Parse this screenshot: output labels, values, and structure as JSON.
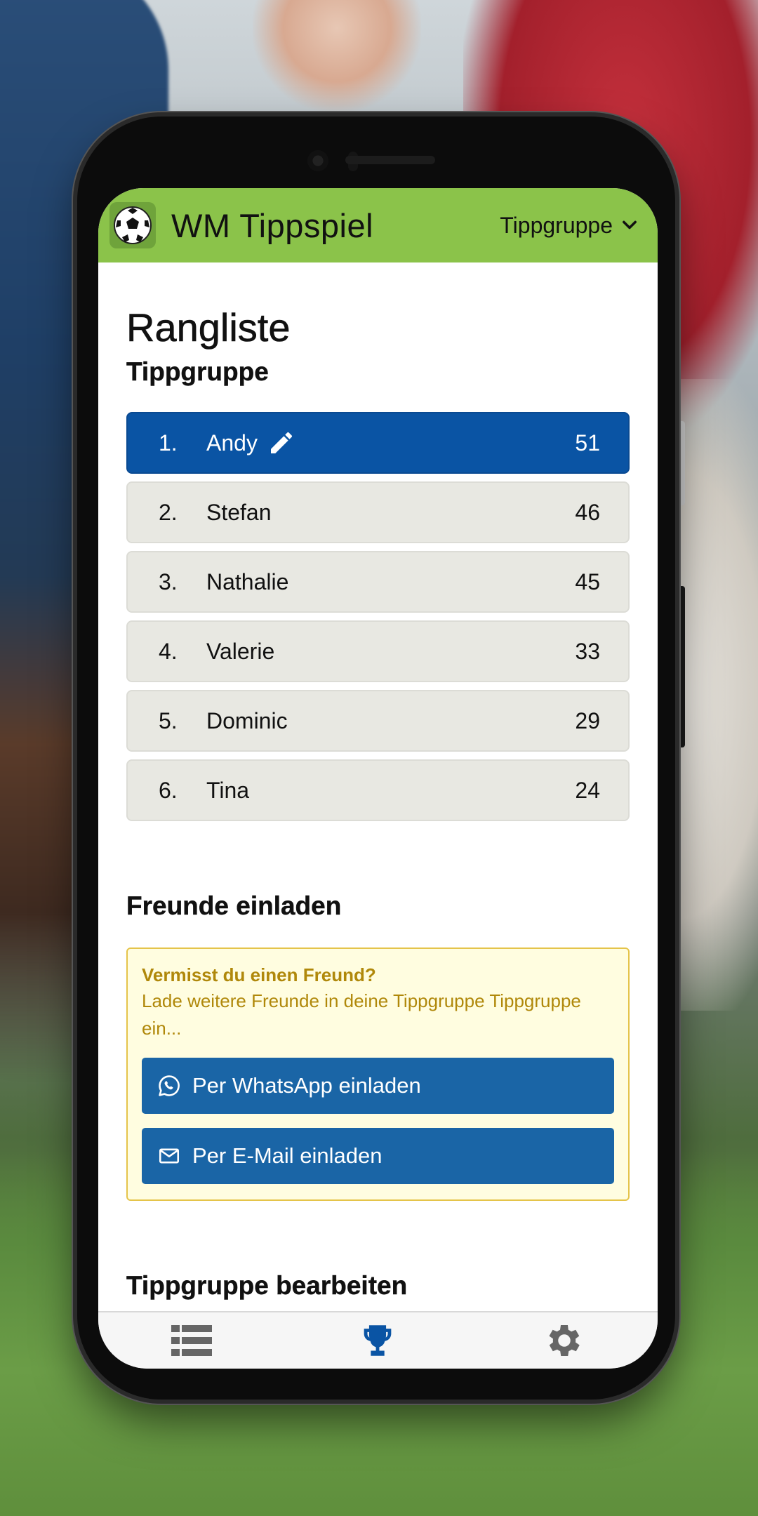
{
  "app": {
    "title": "WM Tippspiel",
    "group_selector": "Tippgruppe"
  },
  "page": {
    "title": "Rangliste",
    "subtitle": "Tippgruppe"
  },
  "ranking": [
    {
      "pos": "1.",
      "name": "Andy",
      "points": "51",
      "active": true
    },
    {
      "pos": "2.",
      "name": "Stefan",
      "points": "46",
      "active": false
    },
    {
      "pos": "3.",
      "name": "Nathalie",
      "points": "45",
      "active": false
    },
    {
      "pos": "4.",
      "name": "Valerie",
      "points": "33",
      "active": false
    },
    {
      "pos": "5.",
      "name": "Dominic",
      "points": "29",
      "active": false
    },
    {
      "pos": "6.",
      "name": "Tina",
      "points": "24",
      "active": false
    }
  ],
  "invite": {
    "section_title": "Freunde einladen",
    "heading": "Vermisst du einen Freund?",
    "text": "Lade weitere Freunde in deine Tippgruppe Tippgruppe ein...",
    "whatsapp_label": "Per WhatsApp einladen",
    "email_label": "Per E-Mail einladen"
  },
  "edit_section": {
    "title": "Tippgruppe bearbeiten"
  },
  "nav": [
    {
      "icon": "list-icon",
      "active": false
    },
    {
      "icon": "trophy-icon",
      "active": true
    },
    {
      "icon": "gear-icon",
      "active": false
    }
  ],
  "colors": {
    "appbar": "#8bc34a",
    "active_row": "#0a54a4",
    "row": "#e8e8e2",
    "invite_bg": "#fffde0",
    "invite_text": "#b0880a",
    "button": "#1a65a6",
    "nav_active": "#0a54a4",
    "nav_inactive": "#666666"
  }
}
